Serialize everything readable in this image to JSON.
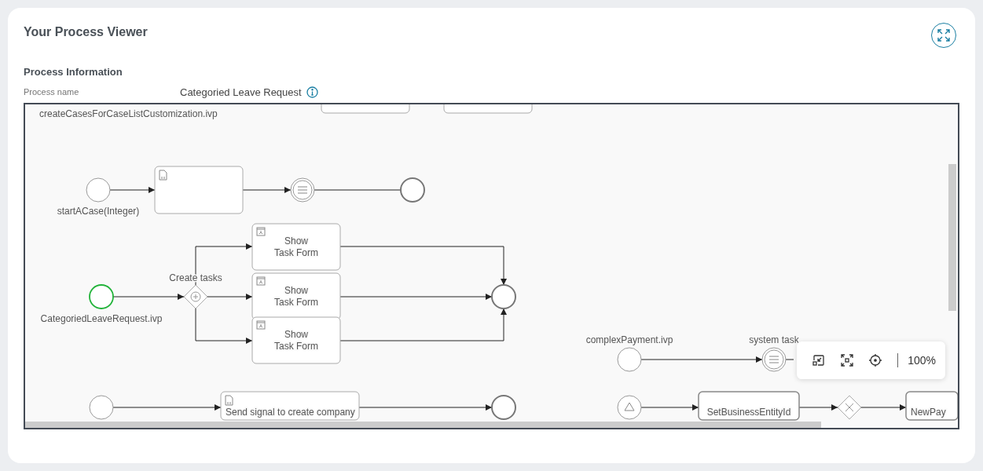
{
  "title": "Your Process Viewer",
  "section": {
    "heading": "Process Information",
    "field_label": "Process name",
    "field_value": "Categoried Leave Request"
  },
  "diagram": {
    "file_label": "createCasesForCaseListCustomization.ivp",
    "nodes": [
      {
        "kind": "task",
        "highlighted": false
      },
      {
        "kind": "task",
        "highlighted": false
      },
      {
        "kind": "start",
        "label": "startACase(Integer)",
        "highlighted": false
      },
      {
        "kind": "script_task",
        "highlighted": false
      },
      {
        "kind": "intermediate",
        "highlighted": false
      },
      {
        "kind": "end",
        "highlighted": false
      },
      {
        "kind": "start",
        "label": "CategoriedLeaveRequest.ivp",
        "highlighted": true
      },
      {
        "kind": "parallel_gateway",
        "label": "Create tasks",
        "highlighted": false
      },
      {
        "kind": "user_task",
        "lines": [
          "Show",
          "Task Form"
        ],
        "highlighted": false
      },
      {
        "kind": "user_task",
        "lines": [
          "Show",
          "Task Form"
        ],
        "highlighted": false
      },
      {
        "kind": "user_task",
        "lines": [
          "Show",
          "Task Form"
        ],
        "highlighted": false
      },
      {
        "kind": "end",
        "highlighted": false
      },
      {
        "kind": "start",
        "label": "complexPayment.ivp",
        "highlighted": false
      },
      {
        "kind": "intermediate",
        "label": "system task",
        "highlighted": false
      },
      {
        "kind": "start",
        "highlighted": false
      },
      {
        "kind": "script_task",
        "label": "Send signal to create company",
        "highlighted": false
      },
      {
        "kind": "end",
        "highlighted": false
      },
      {
        "kind": "signal_start",
        "highlighted": false
      },
      {
        "kind": "task",
        "label": "SetBusinessEntityId",
        "highlighted": false
      },
      {
        "kind": "exclusive_gateway",
        "highlighted": false
      },
      {
        "kind": "task",
        "label": "NewPay",
        "highlighted": false
      }
    ]
  },
  "zoom": {
    "level_text": "100%"
  }
}
